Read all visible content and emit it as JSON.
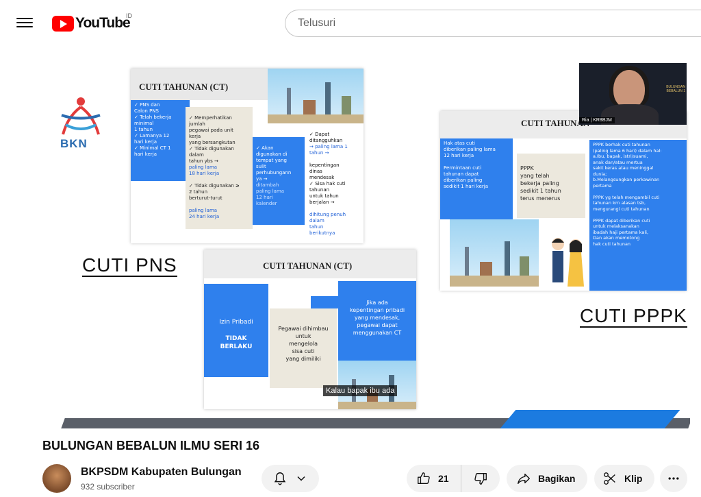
{
  "header": {
    "logo_text": "YouTube",
    "country_code": "ID",
    "search_placeholder": "Telusuri"
  },
  "slide": {
    "bkn_logo_text": "BKN",
    "card1": {
      "title": "CUTI TAHUNAN (CT)",
      "box1": "✓ PNS dan\nCalon PNS\n✓ Telah bekerja\nminimal\n1 tahun\n✓ Lamanya 12\nhari kerja\n✓ Minimal CT 1\nhari kerja",
      "box2_a": "✓ Memperhatikan\njumlah\npegawai pada unit\nkerja\nyang bersangkutan\n✓ Tidak digunakan\ndalam\ntahun  ybs →",
      "box2_b": "paling lama\n18 hari kerja",
      "box2_c": "✓ Tidak digunakan ≥\n2 tahun\nberturut-turut",
      "box2_d": "paling lama\n24 hari kerja",
      "box3_a": "✓ Akan\ndigunakan di\ntempat yang\nsulit\nperhubungann\nya →",
      "box3_b": "ditambah\npaling lama\n12 hari\nkalender",
      "box4_a": "✓ Dapat\nditangguhkan",
      "box4_b": "→ paling lama 1\ntahun →",
      "box4_c": "kepentingan\ndinas\nmendesak\n✓ Sisa hak cuti\ntahunan\nuntuk tahun\nberjalan →",
      "box4_d": "dihitung penuh\ndalam\ntahun\nberikutnya"
    },
    "label_pns": "CUTI PNS",
    "card2": {
      "title": "CUTI TAHUNAN (CT)",
      "box1_a": "Izin Pribadi",
      "box1_b": "TIDAK\nBERLAKU",
      "box2": "Pegawai dihimbau\nuntuk\nmengelola\nsisa cuti\nyang dimiliki",
      "box3": "Jika ada\nkepentingan pribadi\nyang mendesak,\npegawai dapat\nmenggunakan CT"
    },
    "card3": {
      "title": "CUTI TAHUNAN",
      "box1": "Hak atas cuti\ndiberikan paling lama\n12 hari kerja\n\nPermintaan cuti\ntahunan dapat\ndiberikan paling\nsedikit 1 hari kerja",
      "box2": "PPPK\nyang telah\nbekerja paling\nsedikit 1 tahun\nterus menerus",
      "box3": "PPPK berhak cuti tahunan\n(paling lama 6 hari) dalam hal:\na.Ibu, bapak, istri/suami,\n   anak dan/atau mertua\n   sakit keras atau meninggal\n   dunia;\nb.Melangsungkan perkawinan\n   pertama\n\nPPPK yg telah mengambil cuti\ntahunan krn alasan tsb,\nmengurangi cuti tahunan\n\nPPPK dapat diberikan cuti\nuntuk melaksanakan\nibadah haji pertama kali,\nDan akan memotong\nhak cuti tahunan"
    },
    "label_pppk": "CUTI PPPK",
    "webcam_name": "Ria | KR8BJM",
    "webcam_side_text": "BULUNGAN\nBEBALUN 1",
    "caption": "Kalau bapak ibu ada"
  },
  "video": {
    "title": "BULUNGAN BEBALUN ILMU SERI 16"
  },
  "channel": {
    "name": "BKPSDM Kabupaten Bulungan",
    "subscribers": "932 subscriber"
  },
  "actions": {
    "like_count": "21",
    "share_label": "Bagikan",
    "clip_label": "Klip"
  },
  "colors": {
    "youtube_red": "#ff0000",
    "slide_blue": "#2f80ed",
    "slide_beige": "#ece8dd"
  }
}
